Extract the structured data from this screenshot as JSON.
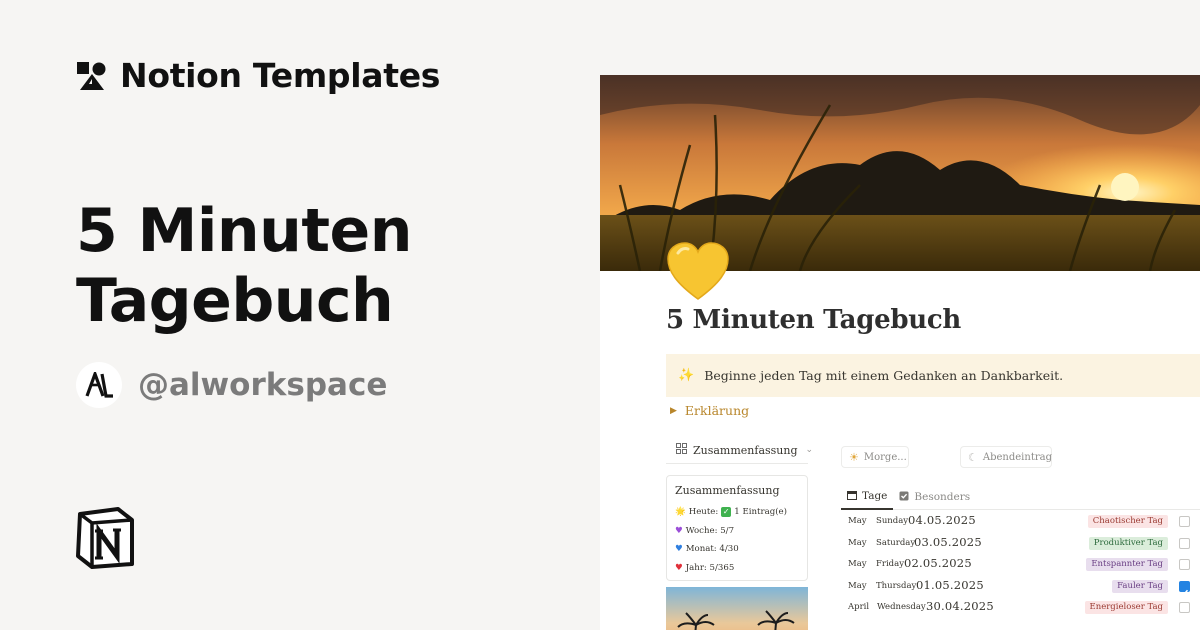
{
  "brand": {
    "name": "Notion Templates",
    "logo_icon": "notion-templates-shapes-icon"
  },
  "hero": {
    "title": "5 Minuten Tagebuch"
  },
  "author": {
    "handle": "@alworkspace",
    "avatar_icon": "al-monogram-icon"
  },
  "footer": {
    "logo_icon": "notion-logo-icon"
  },
  "page": {
    "icon": "yellow-heart-icon",
    "title": "5 Minuten Tagebuch",
    "callout": {
      "icon": "sparkles-icon",
      "text": "Beginne jeden Tag mit einem Gedanken an Dankbarkeit."
    },
    "toggle": {
      "label": "Erklärung"
    },
    "view": {
      "label": "Zusammenfassung"
    },
    "summary": {
      "title": "Zusammenfassung",
      "heute_label": "Heute:",
      "heute_value": "1 Eintrag(e)",
      "woche": "Woche: 5/7",
      "monat": "Monat: 4/30",
      "jahr": "Jahr: 5/365"
    },
    "buttons": {
      "morning": "Morge...",
      "evening": "Abendeintrag"
    },
    "tabs": [
      {
        "label": "Tage"
      },
      {
        "label": "Besonders"
      }
    ],
    "rows": [
      {
        "month": "May",
        "weekday": "Sunday",
        "date": "04.05.2025",
        "tag": "Chaotischer Tag",
        "checked": false
      },
      {
        "month": "May",
        "weekday": "Saturday",
        "date": "03.05.2025",
        "tag": "Produktiver Tag",
        "checked": false
      },
      {
        "month": "May",
        "weekday": "Friday",
        "date": "02.05.2025",
        "tag": "Entspannter Tag",
        "checked": false
      },
      {
        "month": "May",
        "weekday": "Thursday",
        "date": "01.05.2025",
        "tag": "Fauler Tag",
        "checked": true
      },
      {
        "month": "April",
        "weekday": "Wednesday",
        "date": "30.04.2025",
        "tag": "Energieloser Tag",
        "checked": false
      }
    ]
  },
  "colors": {
    "background": "#f6f5f3",
    "accent_blue": "#2383e2",
    "callout_bg": "#fbf3e1",
    "toggle_text": "#b8862b",
    "tag_red": "#fbe4e4",
    "tag_green": "#dbeddb",
    "tag_purple": "#e8deee"
  }
}
